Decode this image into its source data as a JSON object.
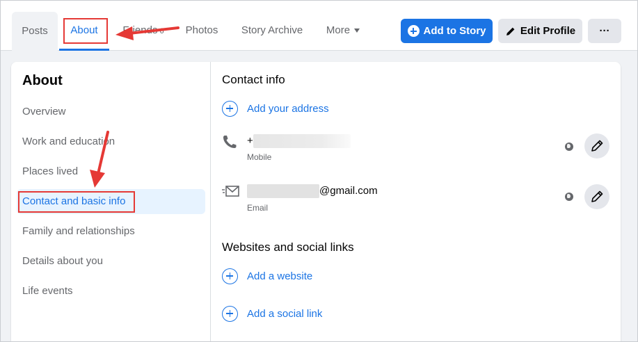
{
  "nav": {
    "tabs": [
      "Posts",
      "About",
      "Friends",
      "Photos",
      "Story Archive",
      "More"
    ],
    "friends_count": "6",
    "add_story": "Add to Story",
    "edit_profile": "Edit Profile",
    "more_options": "···"
  },
  "sidebar": {
    "title": "About",
    "items": [
      "Overview",
      "Work and education",
      "Places lived",
      "Contact and basic info",
      "Family and relationships",
      "Details about you",
      "Life events"
    ]
  },
  "contact": {
    "title": "Contact info",
    "add_address": "Add your address",
    "phone_prefix": "+",
    "phone_type": "Mobile",
    "email_suffix": "@gmail.com",
    "email_type": "Email"
  },
  "websites": {
    "title": "Websites and social links",
    "add_website": "Add a website",
    "add_social": "Add a social link"
  },
  "colors": {
    "accent": "#1b74e4",
    "annotation": "#e53935"
  }
}
